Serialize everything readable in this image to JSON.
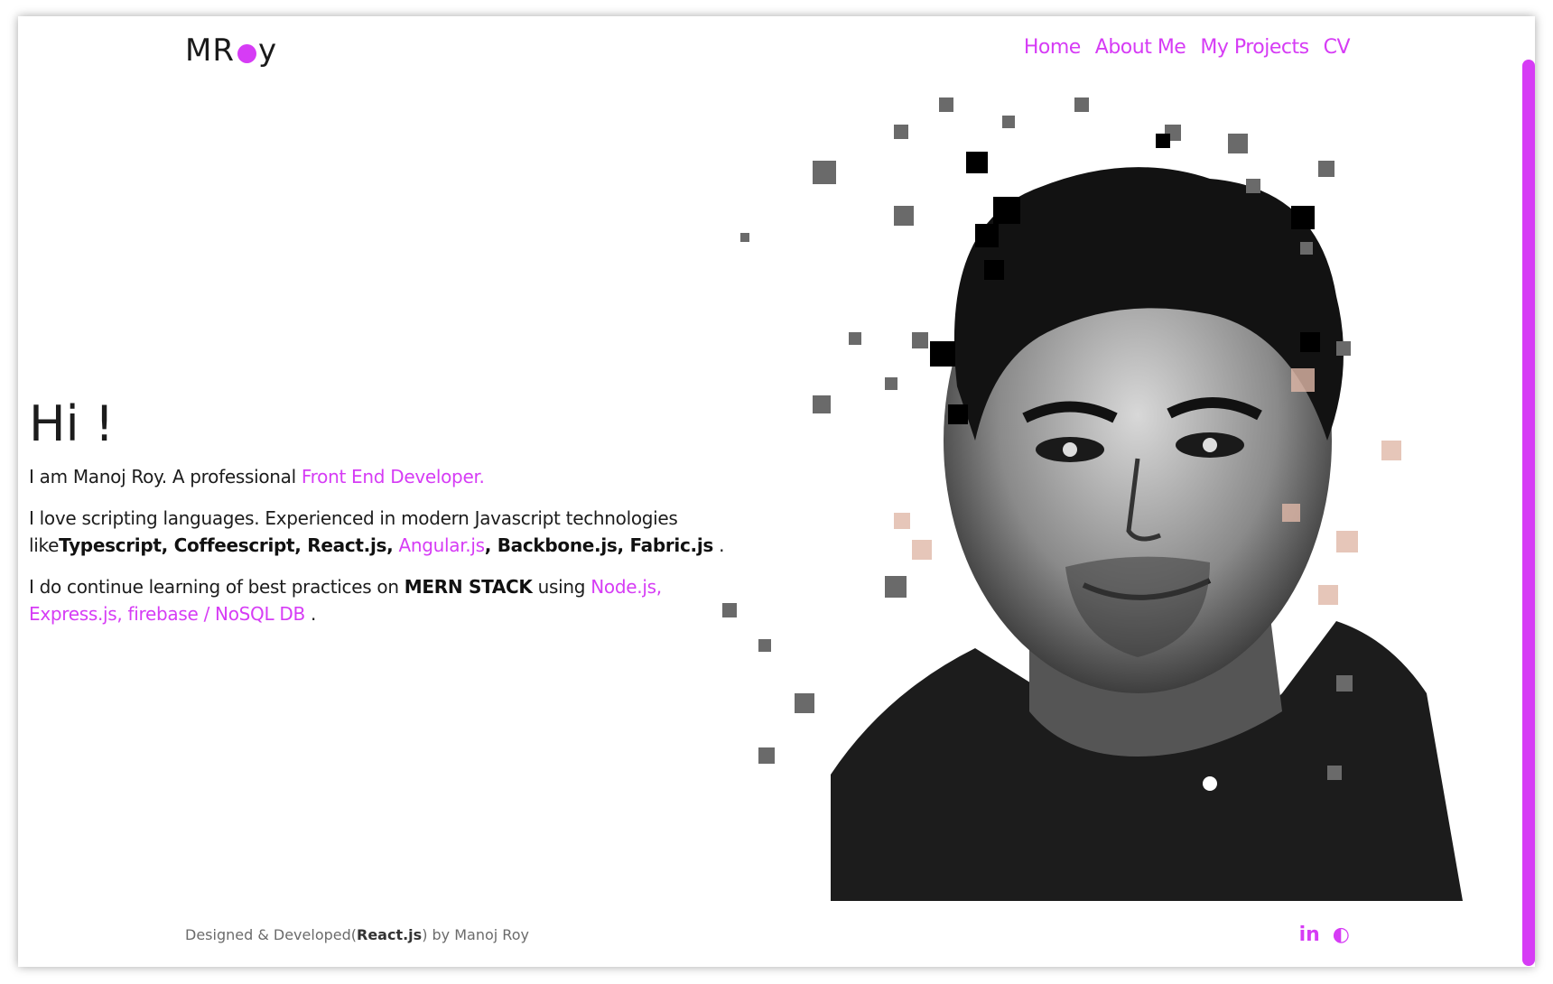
{
  "logo": {
    "text_left": "MR",
    "text_right": "y"
  },
  "nav": {
    "items": [
      "Home",
      "About Me",
      "My Projects",
      "CV"
    ]
  },
  "hero": {
    "heading": "Hi !",
    "line1_prefix": "I am Manoj Roy. A professional ",
    "line1_highlight": "Front End Developer.",
    "para2_text1": "I love scripting languages. Experienced in modern Javascript technologies like",
    "para2_tech1": "Typescript, Coffeescript, React.js,",
    "para2_tech2": " Angular.js",
    "para2_tech3": ", Backbone.js, Fabric.js",
    "para2_tail": " .",
    "para3_text1": "I do continue learning of best practices on ",
    "para3_mern": "MERN STACK",
    "para3_text2": " using ",
    "para3_links": "Node.js, Express.js, firebase / NoSQL DB",
    "para3_tail": " ."
  },
  "footer": {
    "prefix": "Designed & Developed(",
    "framework": "React.js",
    "suffix": ") by Manoj Roy"
  },
  "social": {
    "linkedin_label": "in",
    "github_label": "◐"
  },
  "colors": {
    "accent": "#d63cf5",
    "text": "#1c1c1c"
  }
}
